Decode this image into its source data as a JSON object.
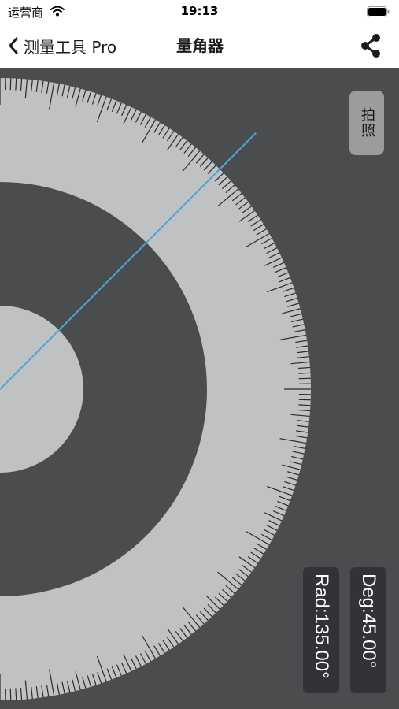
{
  "status_bar": {
    "carrier": "运营商",
    "time": "19:13"
  },
  "nav": {
    "back_label": "测量工具 Pro",
    "title": "量角器",
    "share_icon": "share-icon"
  },
  "photo_button_label": "拍照",
  "readouts": {
    "rad": "Rad:135.00°",
    "deg": "Deg:45.00°"
  },
  "protractor": {
    "angle_degrees": 45
  },
  "colors": {
    "background": "#4b4c4e",
    "scale": "#c0c1c3",
    "ticks": "#2b2b2b",
    "angle_line": "#46a6e0",
    "readout_bg": "#323336",
    "photo_button_bg": "#9c9c9f"
  }
}
